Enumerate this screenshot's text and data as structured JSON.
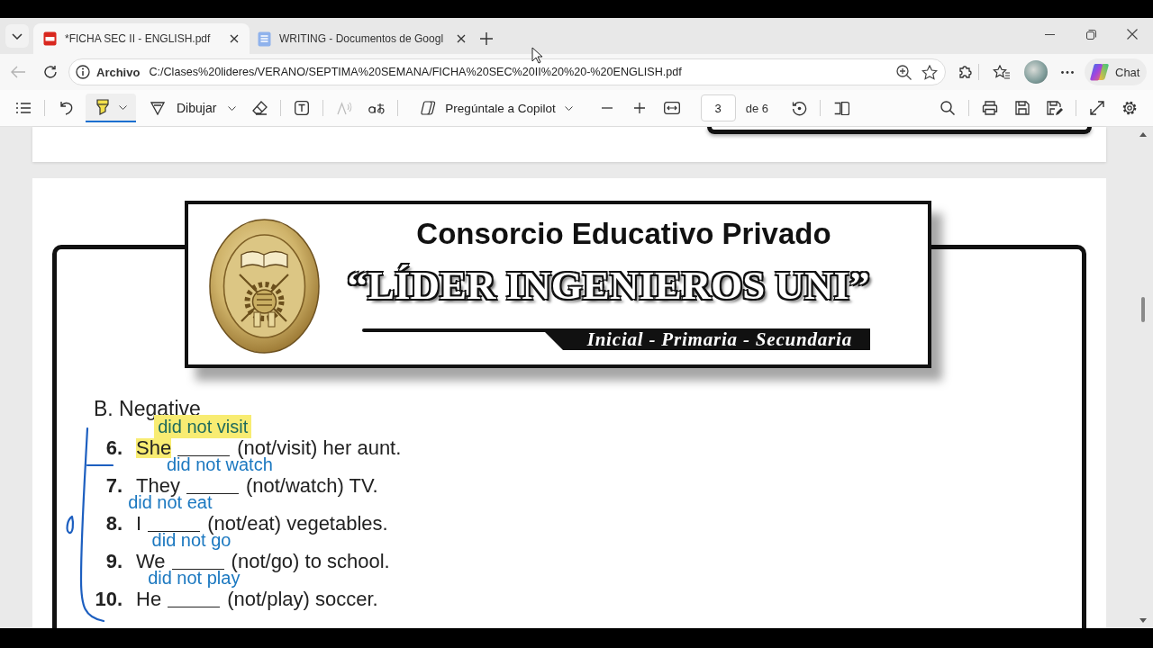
{
  "tabs": [
    {
      "title": "*FICHA SEC II - ENGLISH.pdf",
      "kind": "pdf",
      "selected": true
    },
    {
      "title": "WRITING - Documentos de Googl",
      "kind": "docs",
      "selected": false
    }
  ],
  "address_bar": {
    "origin_label": "Archivo",
    "url": "C:/Clases%20lideres/VERANO/SEPTIMA%20SEMANA/FICHA%20SEC%20II%20%20-%20ENGLISH.pdf"
  },
  "browser_toolbar": {
    "back_disabled": true,
    "chat_label": "Chat"
  },
  "pdf_toolbar": {
    "highlight": {
      "selected": true
    },
    "draw": {
      "label": "Dibujar"
    },
    "read_aloud": {
      "disabled": true
    },
    "copilot": {
      "label": "Pregúntale a Copilot"
    },
    "page": {
      "current": "3",
      "total": "de 6"
    }
  },
  "document": {
    "header": {
      "line1": "Consorcio Educativo Privado",
      "name": "“LÍDER INGENIEROS UNI”",
      "levels": "Inicial - Primaria - Secundaria"
    },
    "section": {
      "title": "B. Negative",
      "exercises": [
        {
          "number": "6.",
          "subject": "She",
          "subject_highlighted": true,
          "prompt": "(not/visit) her aunt.",
          "answer": {
            "text": "did not visit",
            "highlighted": true,
            "color": "#1e6a5c"
          }
        },
        {
          "number": "7.",
          "subject": "They",
          "subject_highlighted": false,
          "prompt": "(not/watch) TV.",
          "answer": {
            "text": "did not watch",
            "highlighted": false,
            "color": "#1b78c0"
          }
        },
        {
          "number": "8.",
          "subject": "I",
          "subject_highlighted": false,
          "prompt": "(not/eat) vegetables.",
          "answer": {
            "text": "did not eat",
            "highlighted": false,
            "color": "#1b78c0"
          }
        },
        {
          "number": "9.",
          "subject": "We",
          "subject_highlighted": false,
          "prompt": "(not/go) to school.",
          "answer": {
            "text": "did not go",
            "highlighted": false,
            "color": "#1b78c0"
          }
        },
        {
          "number": "10.",
          "subject": "He",
          "subject_highlighted": false,
          "prompt": "(not/play) soccer.",
          "answer": {
            "text": "did not play",
            "highlighted": false,
            "color": "#1b78c0"
          }
        }
      ]
    }
  }
}
